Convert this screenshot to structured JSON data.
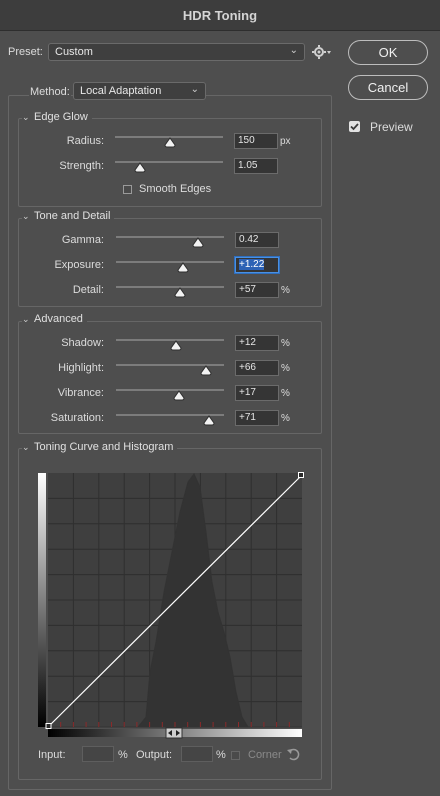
{
  "window": {
    "title": "HDR Toning"
  },
  "preset": {
    "label": "Preset:",
    "value": "Custom"
  },
  "buttons": {
    "ok": "OK",
    "cancel": "Cancel"
  },
  "preview": {
    "label": "Preview",
    "checked": true
  },
  "method": {
    "label": "Method:",
    "value": "Local Adaptation"
  },
  "edge_glow": {
    "title": "Edge Glow",
    "radius": {
      "label": "Radius:",
      "value": "150",
      "unit": "px",
      "level": 0.5
    },
    "strength": {
      "label": "Strength:",
      "value": "1.05",
      "level": 0.22
    },
    "smooth_edges": {
      "label": "Smooth Edges",
      "checked": false
    }
  },
  "tone_detail": {
    "title": "Tone and Detail",
    "gamma": {
      "label": "Gamma:",
      "value": "0.42",
      "level": 0.76
    },
    "exposure": {
      "label": "Exposure:",
      "value": "+1.22",
      "level": 0.62
    },
    "detail": {
      "label": "Detail:",
      "value": "+57",
      "unit": "%",
      "level": 0.59
    }
  },
  "advanced": {
    "title": "Advanced",
    "shadow": {
      "label": "Shadow:",
      "value": "+12",
      "unit": "%",
      "level": 0.56
    },
    "highlight": {
      "label": "Highlight:",
      "value": "+66",
      "unit": "%",
      "level": 0.83
    },
    "vibrance": {
      "label": "Vibrance:",
      "value": "+17",
      "unit": "%",
      "level": 0.59
    },
    "saturation": {
      "label": "Saturation:",
      "value": "+71",
      "unit": "%",
      "level": 0.86
    }
  },
  "curve": {
    "title": "Toning Curve and Histogram",
    "input_label": "Input:",
    "output_label": "Output:",
    "percent": "%",
    "corner_label": "Corner"
  },
  "colors": {
    "background": "#4e4e4e",
    "selection": "#2d62b5",
    "tick_marks": "#8b2a2a"
  },
  "icons": {
    "preset_menu": "gear-icon",
    "reset": "reset-arrow-icon"
  }
}
